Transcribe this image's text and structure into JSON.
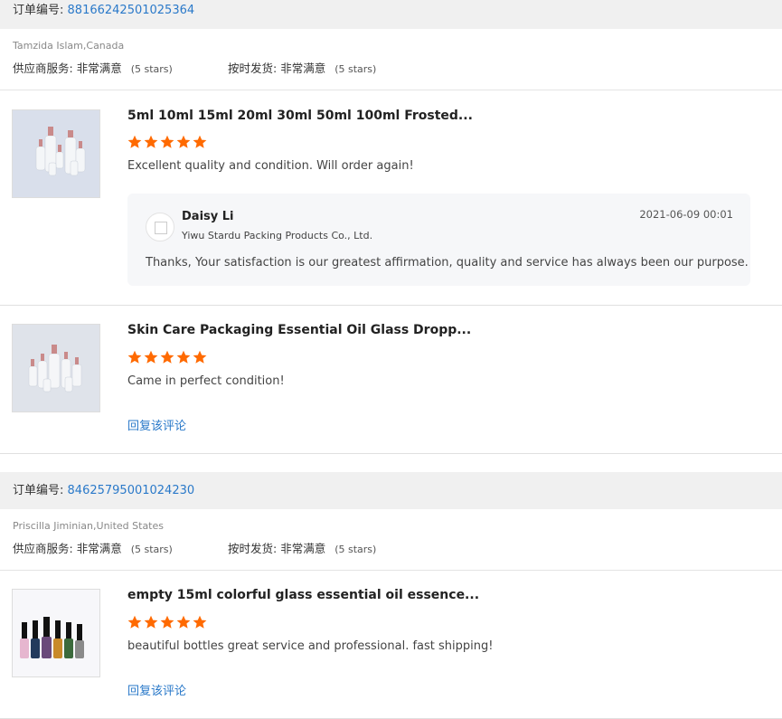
{
  "orders": [
    {
      "label": "订单编号:",
      "number": "88166242501025364",
      "buyer": "Tamzida Islam,Canada",
      "supplier_service_label": "供应商服务:",
      "supplier_service_value": "非常满意",
      "supplier_service_stars": "(5 stars)",
      "delivery_label": "按时发货:",
      "delivery_value": "非常满意",
      "delivery_stars": "(5 stars)",
      "products": [
        {
          "title": "5ml 10ml 15ml 20ml 30ml 50ml 100ml Frosted...",
          "rating": 5,
          "comment": "Excellent quality and condition. Will order again!",
          "reply": {
            "name": "Daisy Li",
            "company": "Yiwu Stardu Packing Products Co., Ltd.",
            "date": "2021-06-09 00:01",
            "text": "Thanks, Your satisfaction is our greatest affirmation, quality and service has always been our purpose."
          }
        },
        {
          "title": "Skin Care Packaging Essential Oil Glass Dropp...",
          "rating": 5,
          "comment": "Came in perfect condition!",
          "reply_link": "回复该评论"
        }
      ]
    },
    {
      "label": "订单编号:",
      "number": "84625795001024230",
      "buyer": "Priscilla Jiminian,United States",
      "supplier_service_label": "供应商服务:",
      "supplier_service_value": "非常满意",
      "supplier_service_stars": "(5 stars)",
      "delivery_label": "按时发货:",
      "delivery_value": "非常满意",
      "delivery_stars": "(5 stars)",
      "products": [
        {
          "title": "empty 15ml colorful glass essential oil essence...",
          "rating": 5,
          "comment": "beautiful bottles great service and professional. fast shipping!",
          "reply_link": "回复该评论"
        }
      ]
    }
  ],
  "colors": {
    "star": "#ff6a00",
    "link": "#2a79c9",
    "bar": "#f0f0f0"
  },
  "icons": {
    "star": "star-icon",
    "avatar": "avatar-icon"
  }
}
